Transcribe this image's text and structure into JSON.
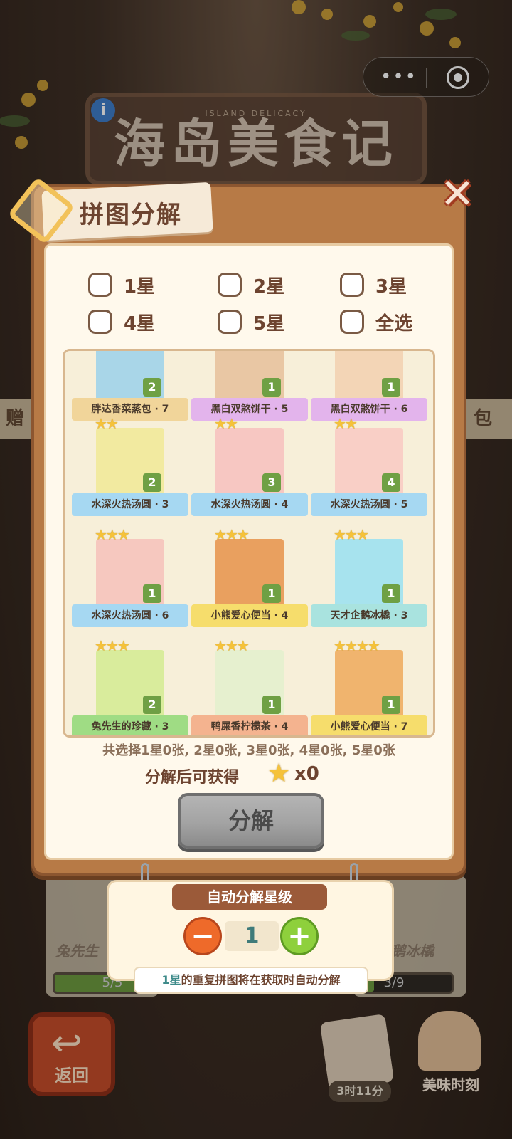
{
  "background": {
    "game_title_en": "ISLAND DELICACY",
    "game_title_cn": "海岛美食记",
    "side_left": "赠",
    "side_right": "包",
    "cards": [
      {
        "name": "兔先生",
        "progress": "5/5",
        "fill": 1.0
      },
      {
        "name": "企鹅冰橇",
        "progress": "3/9",
        "fill": 0.33
      }
    ],
    "back_label": "返回",
    "timer": "3时11分",
    "moment_label": "美味时刻"
  },
  "panel": {
    "title": "拼图分解",
    "filters": [
      {
        "label": "1星",
        "checked": false
      },
      {
        "label": "2星",
        "checked": false
      },
      {
        "label": "3星",
        "checked": false
      },
      {
        "label": "4星",
        "checked": false
      },
      {
        "label": "5星",
        "checked": false
      },
      {
        "label": "全选",
        "checked": false
      }
    ],
    "pieces": [
      {
        "name": "胖达香菜蒸包 · 7",
        "count": "2",
        "stars": "",
        "ribbon": "#f1d59a",
        "art": "#a9d6e8"
      },
      {
        "name": "黑白双煞饼干 · 5",
        "count": "1",
        "stars": "",
        "ribbon": "#e3b4ec",
        "art": "#e9c7a4"
      },
      {
        "name": "黑白双煞饼干 · 6",
        "count": "1",
        "stars": "",
        "ribbon": "#e3b4ec",
        "art": "#f3d5b6"
      },
      {
        "name": "水深火热汤圆 · 3",
        "count": "2",
        "stars": "★★",
        "ribbon": "#a6d8f2",
        "art": "#f2eaa0"
      },
      {
        "name": "水深火热汤圆 · 4",
        "count": "3",
        "stars": "★★",
        "ribbon": "#a6d8f2",
        "art": "#f7c7c2"
      },
      {
        "name": "水深火热汤圆 · 5",
        "count": "4",
        "stars": "★★",
        "ribbon": "#a6d8f2",
        "art": "#f9cfc6"
      },
      {
        "name": "水深火热汤圆 · 6",
        "count": "1",
        "stars": "★★★",
        "ribbon": "#a6d8f2",
        "art": "#f6c8bf"
      },
      {
        "name": "小熊爱心便当 · 4",
        "count": "1",
        "stars": "★★★",
        "ribbon": "#f6dd6c",
        "art": "#e9a05f"
      },
      {
        "name": "天才企鹅冰橇 · 3",
        "count": "1",
        "stars": "★★★",
        "ribbon": "#a9e3df",
        "art": "#a7e3ee"
      },
      {
        "name": "兔先生的珍藏 · 3",
        "count": "2",
        "stars": "★★★",
        "ribbon": "#9fdc84",
        "art": "#d9ec9c"
      },
      {
        "name": "鸭屎香柠檬茶 · 4",
        "count": "1",
        "stars": "★★★",
        "ribbon": "#f4b38f",
        "art": "#e6f0cf"
      },
      {
        "name": "小熊爱心便当 · 7",
        "count": "1",
        "stars": "★★★★",
        "ribbon": "#f6dd6c",
        "art": "#f0b46e"
      }
    ],
    "summary": "共选择1星0张, 2星0张, 3星0张, 4星0张, 5星0张",
    "gain_label": "分解后可获得",
    "gain_amount": "x0",
    "decompose_button": "分解"
  },
  "auto": {
    "title": "自动分解星级",
    "level": "1",
    "minus": "−",
    "plus": "+",
    "tip_highlight": "1星",
    "tip_rest": "的重复拼图将在获取时自动分解"
  },
  "colors": {
    "panel_wood": "#b77a46",
    "panel_paper": "#fff9ec",
    "text_brown": "#6d4430",
    "count_green": "#6fa044",
    "star_gold": "#f5c23a"
  },
  "icons": {
    "info": "info-icon",
    "menu": "more-dots-icon",
    "capsule_close": "target-icon",
    "close": "close-x-icon",
    "puzzle": "puzzle-icon",
    "star": "star-icon",
    "back": "back-arrow-icon"
  }
}
